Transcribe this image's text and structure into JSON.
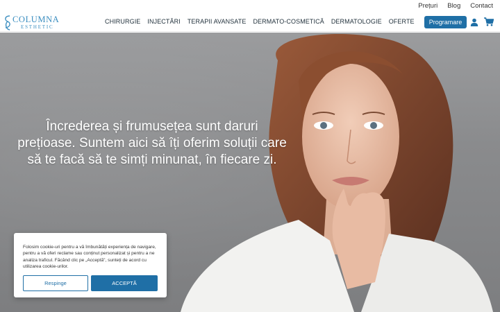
{
  "top_links": {
    "prices": "Prețuri",
    "blog": "Blog",
    "contact": "Contact"
  },
  "logo": {
    "brand": "COLUMNA",
    "sub": "ESTHETIC"
  },
  "nav": [
    "CHIRURGIE",
    "INJECTĂRI",
    "TERAPII AVANSATE",
    "DERMATO-COSMETICĂ",
    "DERMATOLOGIE",
    "OFERTE"
  ],
  "header": {
    "cta_label": "Programare",
    "user_icon": "user-icon",
    "cart_icon": "cart-icon"
  },
  "hero": {
    "headline": "Încrederea și frumusețea sunt daruri prețioase. Suntem aici să îți oferim soluții care să te facă să te simți minunat, în fiecare zi."
  },
  "cookie": {
    "text": "Folosim cookie-uri pentru a vă îmbunătăți experiența de navigare, pentru a vă oferi reclame sau conținut personalizat și pentru a ne analiza traficul. Făcând clic pe „Acceptă\", sunteți de acord cu utilizarea cookie-urilor.",
    "reject_label": "Respinge",
    "accept_label": "ACCEPTĂ"
  },
  "colors": {
    "brand": "#3b8ec0",
    "primary_button": "#1f6fa6"
  }
}
